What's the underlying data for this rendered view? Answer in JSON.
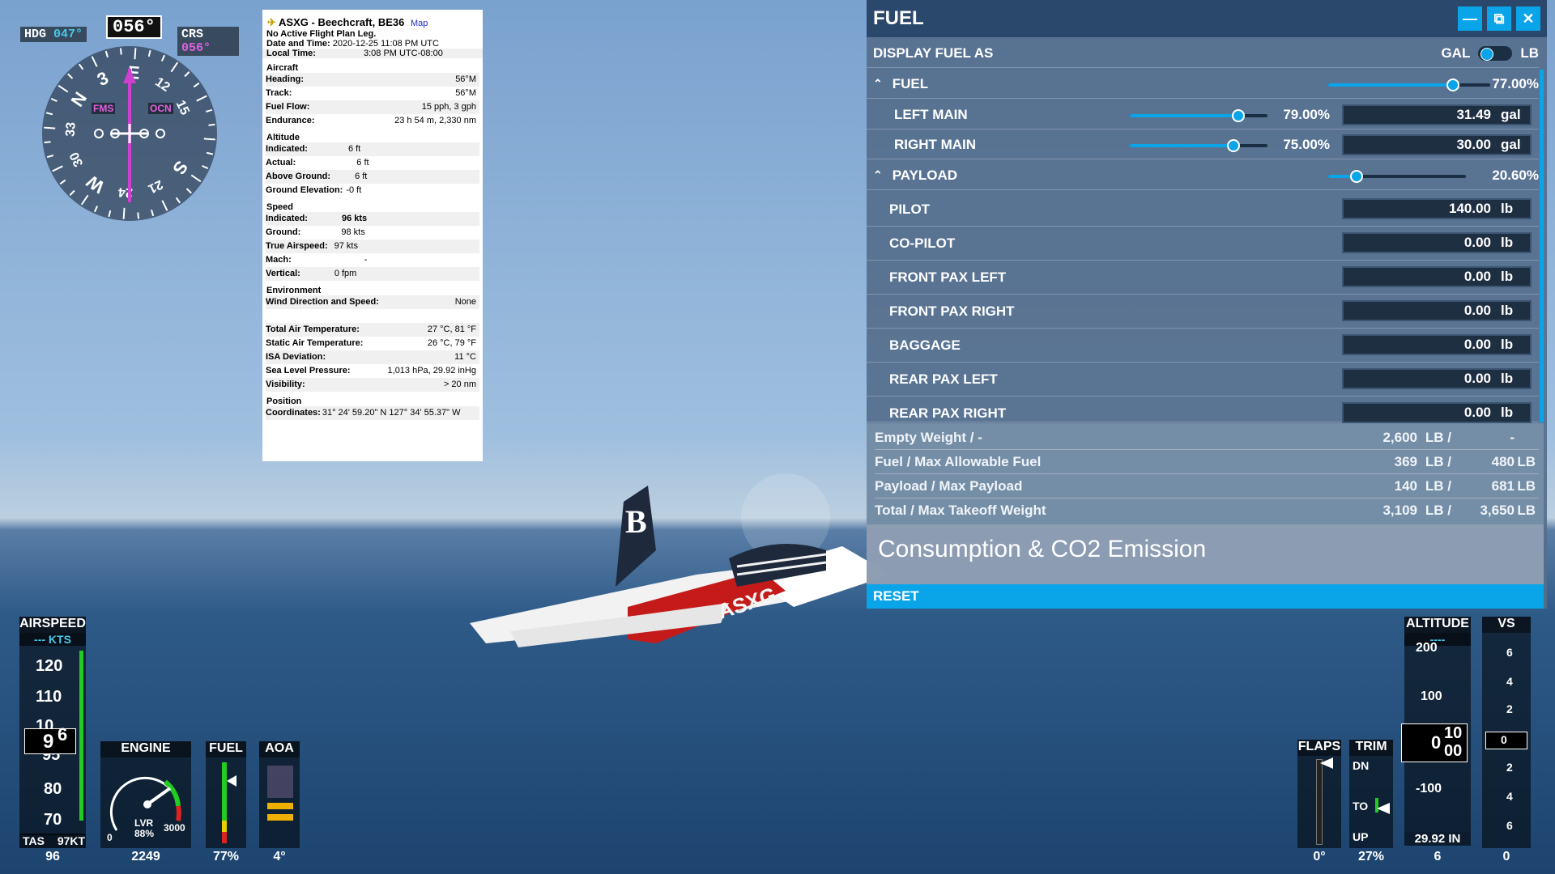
{
  "compass": {
    "heading": "056°",
    "hdg_label": "HDG",
    "hdg_value": "047°",
    "crs_label": "CRS",
    "crs_value": "056°",
    "fms_label": "FMS",
    "ocn_label": "OCN",
    "cardinals": [
      "N",
      "3",
      "E",
      "12",
      "15",
      "S",
      "21",
      "24",
      "W",
      "30",
      "33"
    ]
  },
  "info": {
    "title": "ASXG - Beechcraft, BE36",
    "map_link": "Map",
    "flight_plan": "No Active Flight Plan Leg.",
    "datetime_label": "Date and Time:",
    "datetime_value": "2020-12-25 11:08 PM UTC",
    "localtime_label": "Local Time:",
    "localtime_value": "3:08 PM UTC-08:00",
    "sections": {
      "aircraft": "Aircraft",
      "altitude": "Altitude",
      "speed": "Speed",
      "environment": "Environment",
      "position": "Position"
    },
    "aircraft": [
      {
        "k": "Heading:",
        "v": "56°M"
      },
      {
        "k": "Track:",
        "v": "56°M"
      },
      {
        "k": "Fuel Flow:",
        "v": "15 pph, 3 gph"
      },
      {
        "k": "Endurance:",
        "v": "23 h 54 m, 2,330 nm"
      }
    ],
    "altitude": [
      {
        "k": "Indicated:",
        "v": "6 ft"
      },
      {
        "k": "Actual:",
        "v": "6 ft"
      },
      {
        "k": "Above Ground:",
        "v": "6 ft"
      },
      {
        "k": "Ground Elevation:",
        "v": "-0 ft"
      }
    ],
    "speed": [
      {
        "k": "Indicated:",
        "v": "96 kts"
      },
      {
        "k": "Ground:",
        "v": "98 kts"
      },
      {
        "k": "True Airspeed:",
        "v": "97 kts"
      },
      {
        "k": "Mach:",
        "v": "-"
      },
      {
        "k": "Vertical:",
        "v": "0 fpm"
      }
    ],
    "environment": [
      {
        "k": "Wind Direction and Speed:",
        "v": "None"
      },
      {
        "k": "",
        "v": ""
      },
      {
        "k": "Total Air Temperature:",
        "v": "27 °C, 81 °F"
      },
      {
        "k": "Static Air Temperature:",
        "v": "26 °C, 79 °F"
      },
      {
        "k": "ISA Deviation:",
        "v": "11 °C"
      },
      {
        "k": "Sea Level Pressure:",
        "v": "1,013 hPa, 29.92 inHg"
      },
      {
        "k": "Visibility:",
        "v": "> 20 nm"
      }
    ],
    "coords_label": "Coordinates:",
    "coords_value": "31° 24' 59.20\" N 127° 34' 55.37\" W"
  },
  "fuel_panel": {
    "title": "FUEL",
    "display_label": "DISPLAY FUEL AS",
    "unit_gal": "GAL",
    "unit_lb": "LB",
    "fuel_header": "FUEL",
    "fuel_pct": "77.00%",
    "fuel_level": 0.77,
    "tanks": [
      {
        "name": "LEFT MAIN",
        "pct": "79.00%",
        "level": 0.79,
        "value": "31.49",
        "unit": "gal"
      },
      {
        "name": "RIGHT MAIN",
        "pct": "75.00%",
        "level": 0.75,
        "value": "30.00",
        "unit": "gal"
      }
    ],
    "payload_header": "PAYLOAD",
    "payload_pct": "20.60%",
    "payload_level": 0.206,
    "stations": [
      {
        "name": "PILOT",
        "value": "140.00",
        "unit": "lb"
      },
      {
        "name": "CO-PILOT",
        "value": "0.00",
        "unit": "lb"
      },
      {
        "name": "FRONT PAX LEFT",
        "value": "0.00",
        "unit": "lb"
      },
      {
        "name": "FRONT PAX RIGHT",
        "value": "0.00",
        "unit": "lb"
      },
      {
        "name": "BAGGAGE",
        "value": "0.00",
        "unit": "lb"
      },
      {
        "name": "REAR PAX LEFT",
        "value": "0.00",
        "unit": "lb"
      },
      {
        "name": "REAR PAX RIGHT",
        "value": "0.00",
        "unit": "lb"
      }
    ],
    "summary": [
      {
        "label": "Empty Weight / -",
        "a": "2,600",
        "au": "LB /",
        "b": "-",
        "bu": ""
      },
      {
        "label": "Fuel / Max Allowable Fuel",
        "a": "369",
        "au": "LB /",
        "b": "480",
        "bu": "LB"
      },
      {
        "label": "Payload / Max Payload",
        "a": "140",
        "au": "LB /",
        "b": "681",
        "bu": "LB"
      },
      {
        "label": "Total / Max Takeoff Weight",
        "a": "3,109",
        "au": "LB /",
        "b": "3,650",
        "bu": "LB"
      }
    ],
    "consumption": "Consumption & CO2 Emission",
    "reset": "RESET"
  },
  "airspeed": {
    "title": "AIRSPEED",
    "units": "--- KTS",
    "ticks": [
      "120",
      "110",
      "10",
      "95",
      "80",
      "70"
    ],
    "current_hi": "9",
    "current_lo": "6",
    "tas_label": "TAS",
    "tas_value": "97KT",
    "footer": "96"
  },
  "engine": {
    "title": "ENGINE",
    "lever_label": "LVR",
    "lever_value": "88%",
    "min": "0",
    "max": "3000",
    "footer": "2249"
  },
  "fuel_gauge": {
    "title": "FUEL",
    "footer": "77%"
  },
  "aoa": {
    "title": "AOA",
    "footer": "4°"
  },
  "flaps": {
    "title": "FLAPS",
    "footer": "0°"
  },
  "trim": {
    "title": "TRIM",
    "dn": "DN",
    "to": "TO",
    "up": "UP",
    "footer": "27%"
  },
  "altitude": {
    "title": "ALTITUDE",
    "units": "----",
    "ticks": [
      "200",
      "100",
      "-100"
    ],
    "current": "0",
    "roll_hi": "10",
    "roll_lo": "00",
    "baro": "29.92 IN",
    "footer": "6"
  },
  "vs": {
    "title": "VS",
    "ticks": [
      "6",
      "4",
      "2",
      "2",
      "4",
      "6"
    ],
    "current": "0",
    "footer": "0"
  },
  "aircraft_registration": "ASXG"
}
